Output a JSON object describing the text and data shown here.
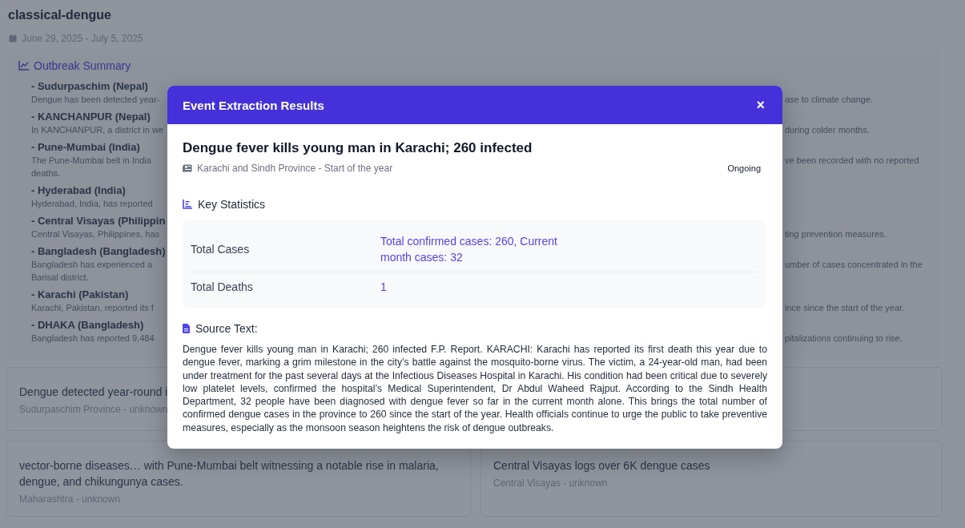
{
  "page": {
    "title": "classical-dengue",
    "date_range": "June 29, 2025 - July 5, 2025"
  },
  "outbreak_summary": {
    "heading": "Outbreak Summary",
    "items": [
      {
        "name": "- Sudurpaschim (Nepal)",
        "text_left": [
          "Dengue has been detected year-"
        ],
        "text_right": [
          "ase to climate change."
        ]
      },
      {
        "name": "- KANCHANPUR (Nepal)",
        "text_left": [
          "In KANCHANPUR, a district in we"
        ],
        "text_right": [
          "during colder months."
        ]
      },
      {
        "name": "- Pune-Mumbai (India)",
        "text_left": [
          "The Pune-Mumbai belt in India",
          "deaths."
        ],
        "text_right": [
          "ve been recorded with no reported"
        ]
      },
      {
        "name": "- Hyderabad (India)",
        "text_left": [
          "Hyderabad, India, has reported"
        ]
      },
      {
        "name": "- Central Visayas (Philippin",
        "text_left": [
          "Central Visayas, Philippines, has"
        ],
        "text_right": [
          "ting prevention measures."
        ]
      },
      {
        "name": "- Bangladesh (Bangladesh)",
        "text_left": [
          "Bangladesh has experienced a",
          "Barisal district."
        ],
        "text_right": [
          "umber of cases concentrated in the"
        ]
      },
      {
        "name": "- Karachi (Pakistan)",
        "text_left": [
          "Karachi, Pakistan, reported its f"
        ],
        "text_right": [
          "ince since the start of the year."
        ]
      },
      {
        "name": "- DHAKA (Bangladesh)",
        "text_left": [
          "Bangladesh has reported 9,484"
        ],
        "text_right": [
          "pitalizations continuing to rise."
        ]
      }
    ]
  },
  "event_cards": [
    {
      "kind": "event",
      "headline": "Dengue detected year-round i",
      "location": "Sudurpaschim Province - unknown"
    },
    {
      "kind": "empty"
    },
    {
      "kind": "event",
      "headline": "vector-borne diseases… with Pune-Mumbai belt witnessing a notable rise in malaria, dengue, and chikungunya cases.",
      "location": "Maharashtra - unknown"
    },
    {
      "kind": "event",
      "headline": "Central Visayas logs over 6K dengue cases",
      "location": "Central Visayas - unknown"
    }
  ],
  "modal": {
    "title": "Event Extraction Results",
    "close": "×",
    "event_title": "Dengue fever kills young man in Karachi; 260 infected",
    "location_time": "Karachi and Sindh Province - Start of the year",
    "status": "Ongoing",
    "stats_heading": "Key Statistics",
    "stats": [
      {
        "label": "Total Cases",
        "value": "Total confirmed cases: 260, Current month cases: 32"
      },
      {
        "label": "Total Deaths",
        "value": "1"
      }
    ],
    "source_heading": "Source Text:",
    "source_text": "Dengue fever kills young man in Karachi; 260 infected F.P. Report. KARACHI: Karachi has reported its first death this year due to dengue fever, marking a grim milestone in the city’s battle against the mosquito-borne virus. The victim, a 24-year-old man, had been under treatment for the past several days at the Infectious Diseases Hospital in Karachi. His condition had been critical due to severely low platelet levels, confirmed the hospital’s Medical Superintendent, Dr Abdul Waheed Rajput. According to the Sindh Health Department, 32 people have been diagnosed with dengue fever so far in the current month alone. This brings the total number of confirmed dengue cases in the province to 260 since the start of the year. Health officials continue to urge the public to take preventive measures, especially as the monsoon season heightens the risk of dengue outbreaks."
  }
}
